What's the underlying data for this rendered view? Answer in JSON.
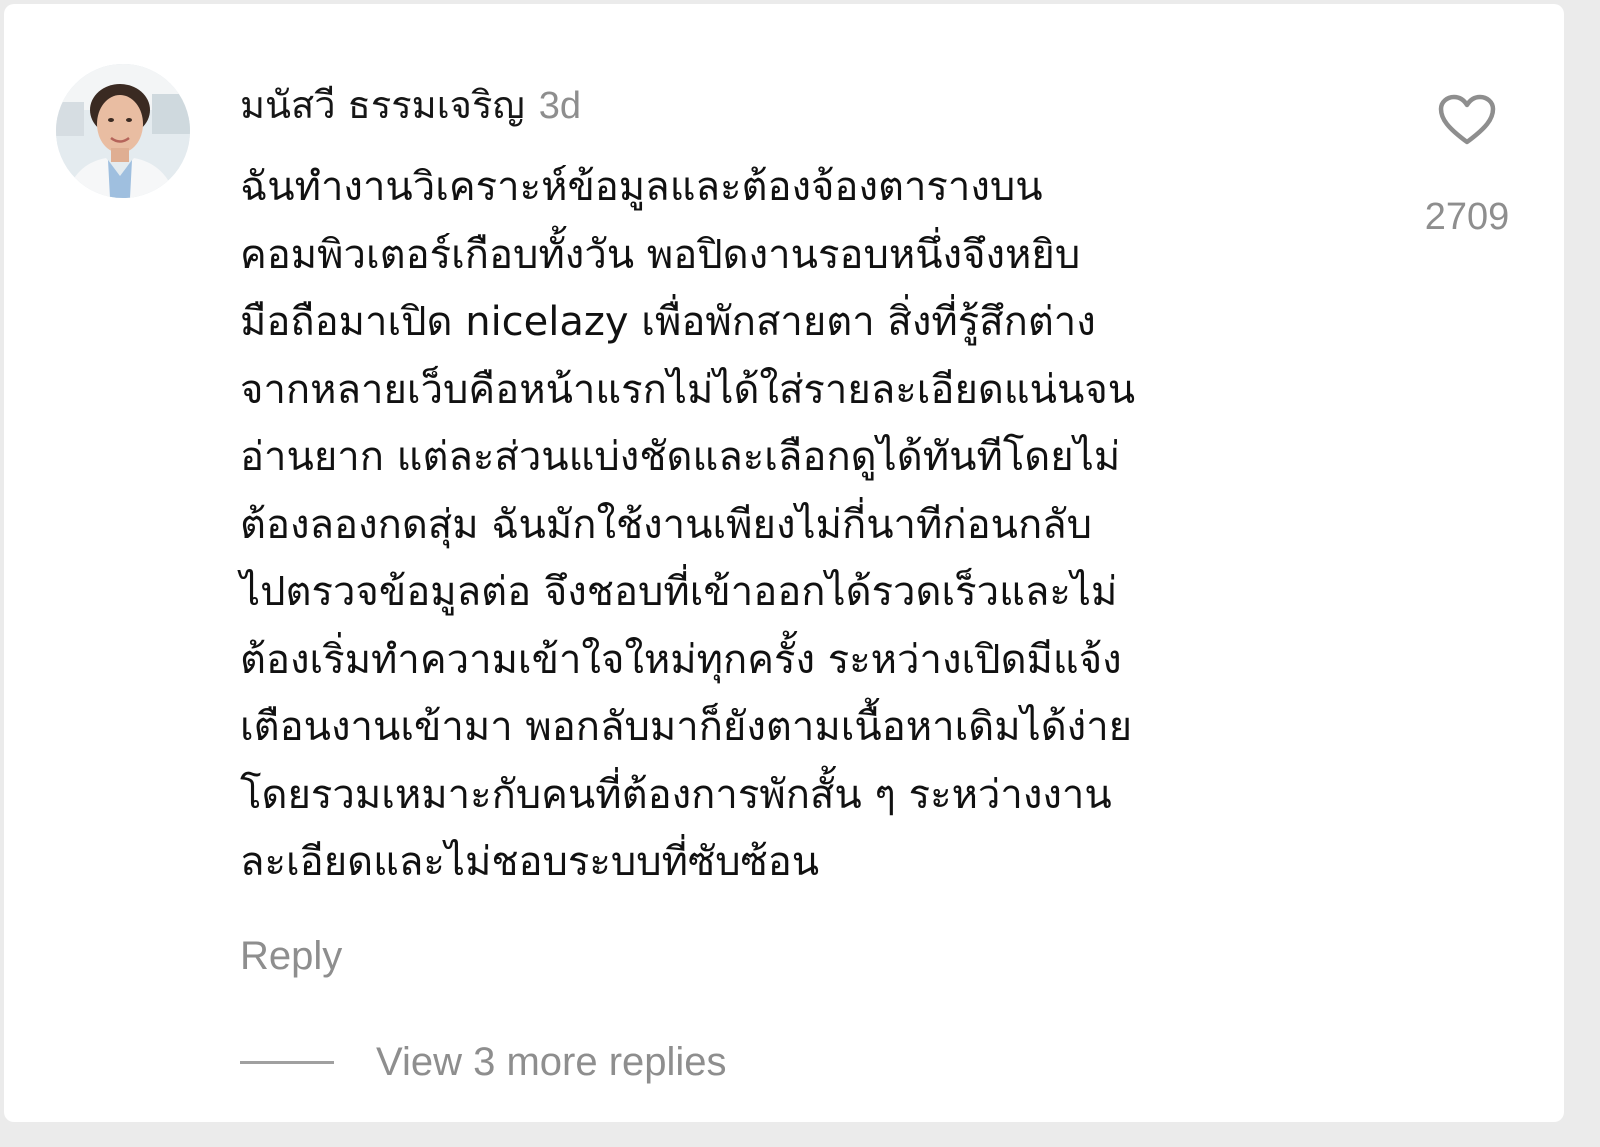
{
  "comment": {
    "avatar_icon": "person-avatar-image",
    "author": "มนัสวี ธรรมเจริญ",
    "time_ago": "3d",
    "body": "ฉันทำงานวิเคราะห์ข้อมูลและต้องจ้องตารางบน\nคอมพิวเตอร์เกือบทั้งวัน พอปิดงานรอบหนึ่งจึงหยิบ\nมือถือมาเปิด nicelazy เพื่อพักสายตา สิ่งที่รู้สึกต่าง\nจากหลายเว็บคือหน้าแรกไม่ได้ใส่รายละเอียดแน่นจน\nอ่านยาก แต่ละส่วนแบ่งชัดและเลือกดูได้ทันทีโดยไม่\nต้องลองกดสุ่ม ฉันมักใช้งานเพียงไม่กี่นาทีก่อนกลับ\nไปตรวจข้อมูลต่อ จึงชอบที่เข้าออกได้รวดเร็วและไม่\nต้องเริ่มทำความเข้าใจใหม่ทุกครั้ง ระหว่างเปิดมีแจ้ง\nเตือนงานเข้ามา พอกลับมาก็ยังตามเนื้อหาเดิมได้ง่าย\nโดยรวมเหมาะกับคนที่ต้องการพักสั้น ๆ ระหว่างงาน\nละเอียดและไม่ชอบระบบที่ซับซ้อน",
    "reply_label": "Reply",
    "view_replies_label": "View 3 more replies",
    "like_icon": "heart-outline-icon",
    "like_count": "2709"
  },
  "colors": {
    "text_primary": "#111111",
    "text_secondary": "#8e8e8e",
    "background": "#ffffff"
  }
}
